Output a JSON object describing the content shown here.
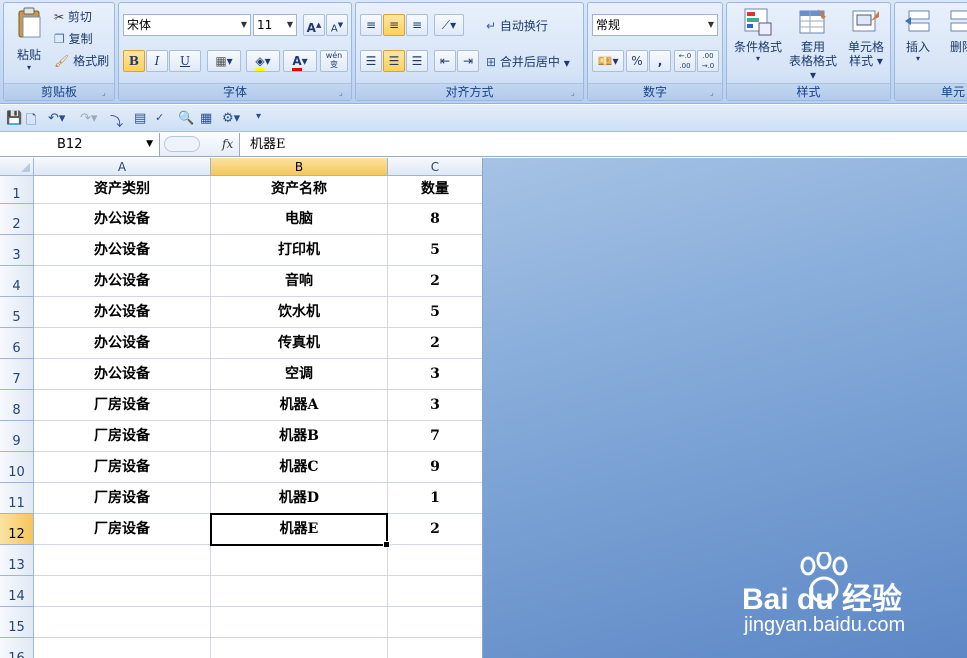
{
  "ribbon": {
    "clipboard": {
      "label": "剪贴板",
      "paste": "粘贴",
      "cut": "剪切",
      "copy": "复制",
      "format_painter": "格式刷"
    },
    "font": {
      "label": "字体",
      "font_name": "宋体",
      "font_size": "11",
      "bold": "B",
      "italic": "I",
      "underline": "U",
      "grow": "A",
      "shrink": "A",
      "phonetic": "wén 变"
    },
    "alignment": {
      "label": "对齐方式",
      "wrap": "自动换行",
      "merge": "合并后居中"
    },
    "number": {
      "label": "数字",
      "format": "常规",
      "percent": "%",
      "comma": ",",
      "inc_dec": "←.0 .00",
      "dec_dec": ".00 →.0"
    },
    "styles": {
      "label": "样式",
      "conditional": "条件格式",
      "table_format_1": "套用",
      "table_format_2": "表格格式",
      "cell_style_1": "单元格",
      "cell_style_2": "样式"
    },
    "cells": {
      "label": "单元",
      "insert": "插入",
      "delete": "删除"
    }
  },
  "formula_bar": {
    "name_box": "B12",
    "fx": "fx",
    "content": "机器E"
  },
  "columns": [
    "A",
    "B",
    "C"
  ],
  "rows": [
    "1",
    "2",
    "3",
    "4",
    "5",
    "6",
    "7",
    "8",
    "9",
    "10",
    "11",
    "12",
    "13",
    "14",
    "15",
    "16"
  ],
  "table": {
    "headers": [
      "资产类别",
      "资产名称",
      "数量"
    ],
    "data": [
      [
        "办公设备",
        "电脑",
        "8"
      ],
      [
        "办公设备",
        "打印机",
        "5"
      ],
      [
        "办公设备",
        "音响",
        "2"
      ],
      [
        "办公设备",
        "饮水机",
        "5"
      ],
      [
        "办公设备",
        "传真机",
        "2"
      ],
      [
        "办公设备",
        "空调",
        "3"
      ],
      [
        "厂房设备",
        "机器A",
        "3"
      ],
      [
        "厂房设备",
        "机器B",
        "7"
      ],
      [
        "厂房设备",
        "机器C",
        "9"
      ],
      [
        "厂房设备",
        "机器D",
        "1"
      ],
      [
        "厂房设备",
        "机器E",
        "2"
      ]
    ]
  },
  "watermark": {
    "brand": "Bai du 经验",
    "url": "jingyan.baidu.com"
  },
  "colors": {
    "selection_header": "#f6c55d",
    "ribbon_text": "#15428b",
    "gridline": "#d0d7e5"
  }
}
